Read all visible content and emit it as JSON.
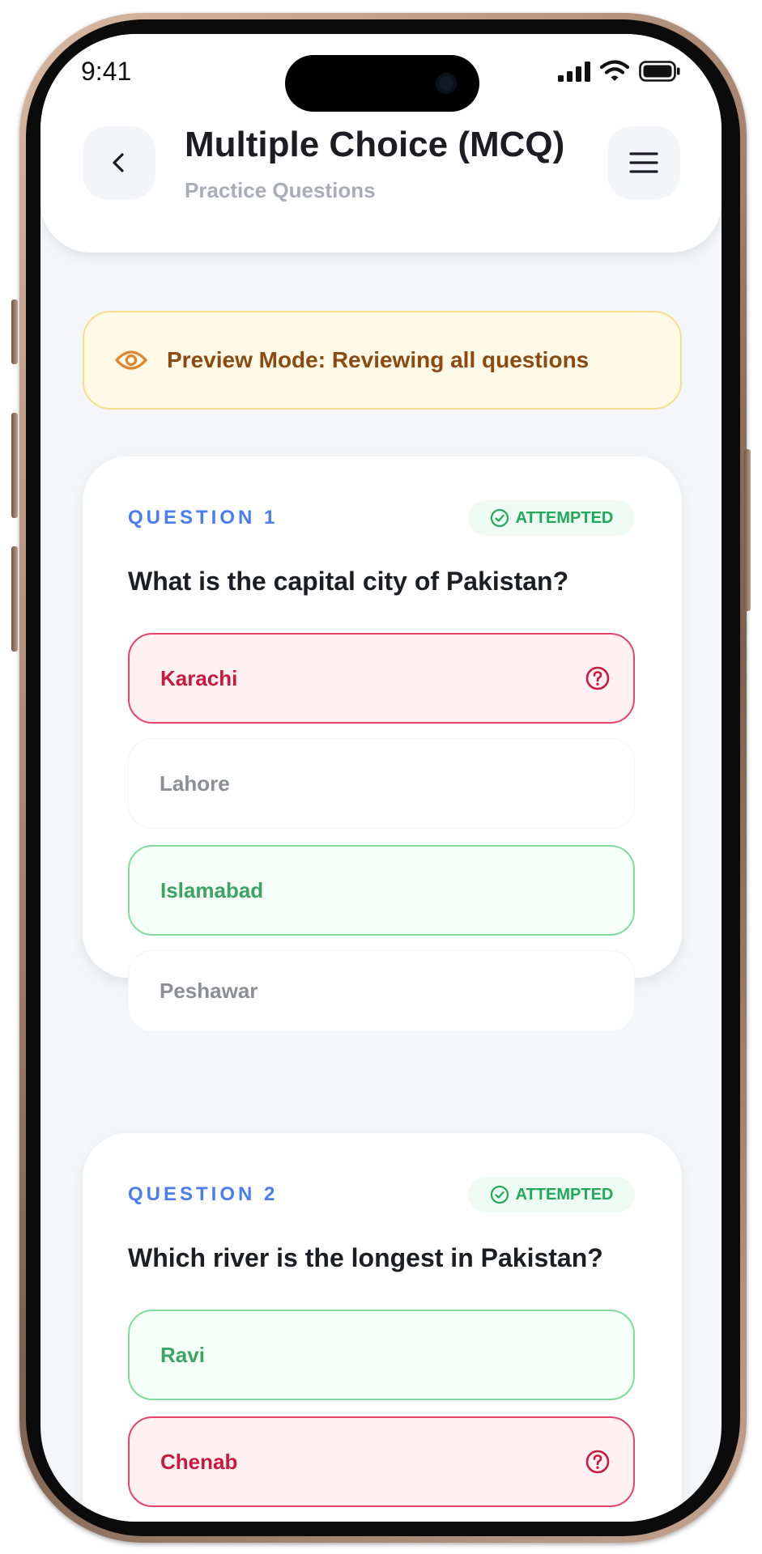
{
  "status": {
    "time": "9:41"
  },
  "header": {
    "title": "Multiple Choice (MCQ)",
    "subtitle": "Practice Questions",
    "back_icon": "chevron-left-icon",
    "menu_icon": "hamburger-menu-icon"
  },
  "banner": {
    "text": "Preview Mode: Reviewing all questions",
    "icon": "eye-icon"
  },
  "colors": {
    "accent_blue": "#4b7cf2",
    "correct_green": "#3ca463",
    "wrong_red": "#c8193f",
    "banner_bg": "#fff9e6",
    "banner_text": "#8a4a12"
  },
  "questions": [
    {
      "label": "QUESTION 1",
      "status": "ATTEMPTED",
      "text": "What is the capital city of Pakistan?",
      "options": [
        {
          "text": "Karachi",
          "state": "wrong"
        },
        {
          "text": "Lahore",
          "state": "neutral"
        },
        {
          "text": "Islamabad",
          "state": "correct"
        },
        {
          "text": "Peshawar",
          "state": "neutral"
        }
      ]
    },
    {
      "label": "QUESTION 2",
      "status": "ATTEMPTED",
      "text": "Which river is the longest in Pakistan?",
      "options": [
        {
          "text": "Ravi",
          "state": "correct"
        },
        {
          "text": "Chenab",
          "state": "wrong"
        }
      ]
    }
  ]
}
